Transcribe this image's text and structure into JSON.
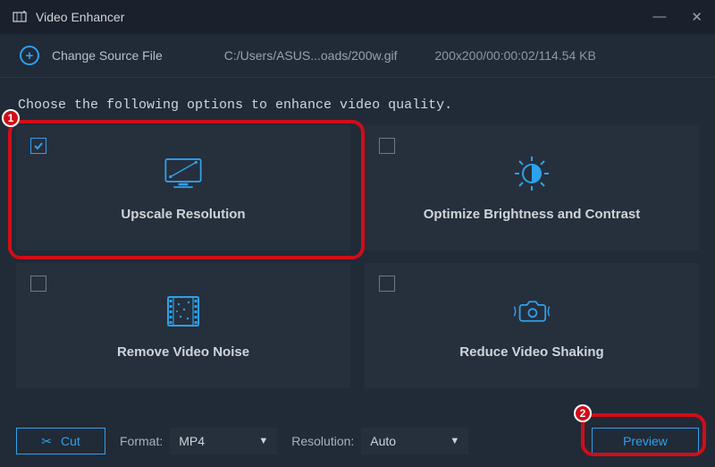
{
  "titlebar": {
    "title": "Video Enhancer"
  },
  "source": {
    "change_label": "Change Source File",
    "path": "C:/Users/ASUS...oads/200w.gif",
    "meta": "200x200/00:00:02/114.54 KB"
  },
  "instruction": "Choose the following options to enhance video quality.",
  "options": [
    {
      "id": "upscale",
      "label": "Upscale Resolution",
      "checked": true
    },
    {
      "id": "optimize",
      "label": "Optimize Brightness and Contrast",
      "checked": false
    },
    {
      "id": "denoise",
      "label": "Remove Video Noise",
      "checked": false
    },
    {
      "id": "deshake",
      "label": "Reduce Video Shaking",
      "checked": false
    }
  ],
  "bottom": {
    "cut_label": "Cut",
    "format_label": "Format:",
    "format_value": "MP4",
    "resolution_label": "Resolution:",
    "resolution_value": "Auto",
    "preview_label": "Preview"
  },
  "annotations": {
    "one": "1",
    "two": "2"
  },
  "colors": {
    "accent": "#2ea1ec",
    "annot": "#d00d18",
    "panel": "#262f3c",
    "bg": "#212a37"
  }
}
